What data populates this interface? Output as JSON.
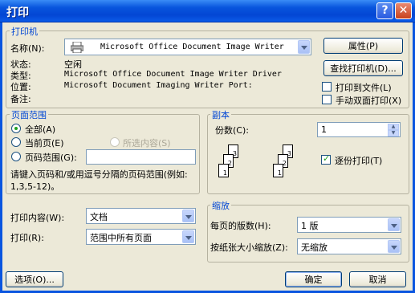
{
  "window": {
    "title": "打印"
  },
  "printer_group": {
    "label": "打印机",
    "name_label": "名称(N):",
    "name_value": "Microsoft Office Document Image Writer",
    "properties_button": "属性(P)",
    "find_printer_button": "查找打印机(D)...",
    "status_label": "状态:",
    "status_value": "空闲",
    "type_label": "类型:",
    "type_value": "Microsoft Office Document Image Writer Driver",
    "where_label": "位置:",
    "where_value": "Microsoft Document Imaging Writer Port:",
    "comment_label": "备注:",
    "print_to_file": "打印到文件(L)",
    "manual_duplex": "手动双面打印(X)"
  },
  "page_range": {
    "label": "页面范围",
    "all": "全部(A)",
    "current": "当前页(E)",
    "selection": "所选内容(S)",
    "pages": "页码范围(G):",
    "pages_value": "",
    "hint": "请键入页码和/或用逗号分隔的页码范围(例如: 1,3,5-12)。"
  },
  "copies": {
    "label": "副本",
    "count_label": "份数(C):",
    "count_value": "1",
    "collate": "逐份打印(T)",
    "page_numbers": [
      "1",
      "2",
      "3"
    ]
  },
  "print_what": {
    "label": "打印内容(W):",
    "value": "文档"
  },
  "print_which": {
    "label": "打印(R):",
    "value": "范围中所有页面"
  },
  "zoom": {
    "label": "缩放",
    "pages_per_sheet_label": "每页的版数(H):",
    "pages_per_sheet_value": "1 版",
    "scale_label": "按纸张大小缩放(Z):",
    "scale_value": "无缩放"
  },
  "footer": {
    "options": "选项(O)...",
    "ok": "确定",
    "cancel": "取消"
  },
  "icons": {
    "printer": "printer-icon",
    "help": "help-icon",
    "close": "close-icon"
  }
}
